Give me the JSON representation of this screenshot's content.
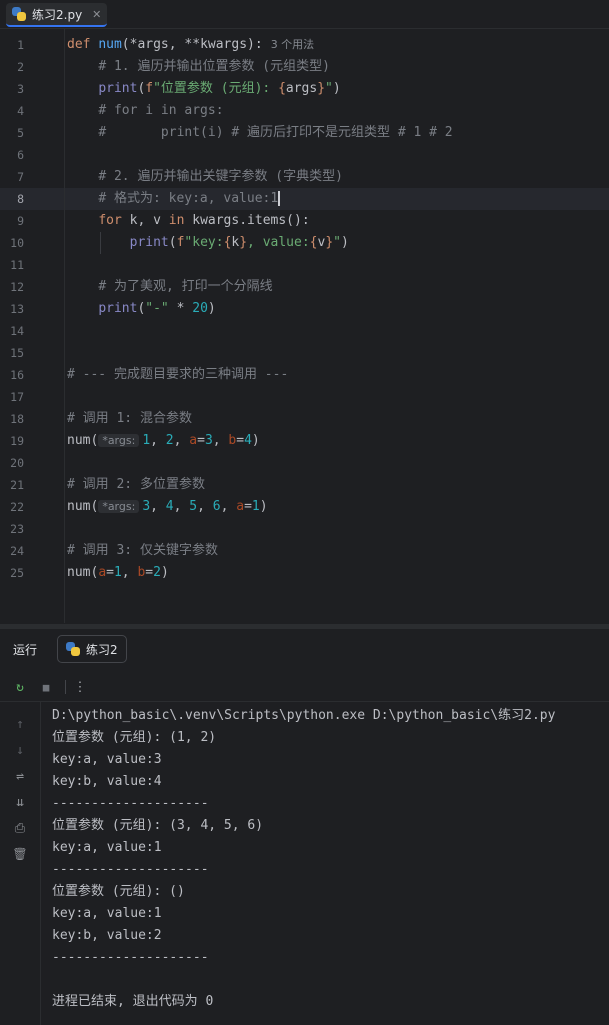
{
  "tab": {
    "filename": "练习2.py",
    "close": "✕"
  },
  "editor": {
    "line_numbers": [
      "1",
      "2",
      "3",
      "4",
      "5",
      "6",
      "7",
      "8",
      "9",
      "10",
      "11",
      "12",
      "13",
      "14",
      "15",
      "16",
      "17",
      "18",
      "19",
      "20",
      "21",
      "22",
      "23",
      "24",
      "25"
    ],
    "current_line": "8",
    "usages_hint": "3 个用法",
    "inlay_args": "*args:",
    "lines": {
      "l1": {
        "def": "def ",
        "name": "num",
        "sig": "(*args, **kwargs):"
      },
      "l2": "# 1. 遍历并输出位置参数 (元组类型)",
      "l3": {
        "fn": "print",
        "open": "(",
        "f": "f",
        "str1": "\"位置参数 (元组): ",
        "lb": "{",
        "var": "args",
        "rb": "}",
        "str2": "\"",
        "close": ")"
      },
      "l4": "# for i in args:",
      "l5": "#       print(i) # 遍历后打印不是元组类型 # 1 # 2",
      "l7": "# 2. 遍历并输出关键字参数 (字典类型)",
      "l8": "# 格式为: key:a, value:1",
      "l9": {
        "for": "for ",
        "vars": "k, v ",
        "in": "in ",
        "expr": "kwargs.items():"
      },
      "l10": {
        "fn": "print",
        "open": "(",
        "f": "f",
        "str1": "\"key:",
        "lb1": "{",
        "k": "k",
        "rb1": "}",
        "str2": ", value:",
        "lb2": "{",
        "v": "v",
        "rb2": "}",
        "str3": "\"",
        "close": ")"
      },
      "l12": "# 为了美观, 打印一个分隔线",
      "l13": {
        "fn": "print",
        "open": "(",
        "str": "\"-\"",
        "op": " * ",
        "num": "20",
        "close": ")"
      },
      "l16": "# --- 完成题目要求的三种调用 ---",
      "l18": "# 调用 1: 混合参数",
      "l19": {
        "name": "num",
        "open": "(",
        "a1": "1",
        "c1": ", ",
        "a2": "2",
        "c2": ", ",
        "ka": "a",
        "eq1": "=",
        "va": "3",
        "c3": ", ",
        "kb": "b",
        "eq2": "=",
        "vb": "4",
        "close": ")"
      },
      "l21": "# 调用 2: 多位置参数",
      "l22": {
        "name": "num",
        "open": "(",
        "a1": "3",
        "c1": ", ",
        "a2": "4",
        "c2": ", ",
        "a3": "5",
        "c3": ", ",
        "a4": "6",
        "c4": ", ",
        "ka": "a",
        "eq": "=",
        "va": "1",
        "close": ")"
      },
      "l24": "# 调用 3: 仅关键字参数",
      "l25": {
        "name": "num",
        "open": "(",
        "ka": "a",
        "eq1": "=",
        "va": "1",
        "c1": ", ",
        "kb": "b",
        "eq2": "=",
        "vb": "2",
        "close": ")"
      }
    }
  },
  "run_panel": {
    "label": "运行",
    "tab_name": "练习2",
    "output": [
      "D:\\python_basic\\.venv\\Scripts\\python.exe D:\\python_basic\\练习2.py",
      "位置参数 (元组): (1, 2)",
      "key:a, value:3",
      "key:b, value:4",
      "--------------------",
      "位置参数 (元组): (3, 4, 5, 6)",
      "key:a, value:1",
      "--------------------",
      "位置参数 (元组): ()",
      "key:a, value:1",
      "key:b, value:2",
      "--------------------",
      "",
      "进程已结束, 退出代码为 0"
    ]
  },
  "icons": {
    "rerun": "↻",
    "stop": "■",
    "more": "⋮",
    "up": "↑",
    "down": "↓",
    "wrap": "⇌",
    "scroll_end": "⇊",
    "print": "⎙",
    "trash": "🗑"
  },
  "colors": {
    "accent": "#3574f0",
    "background": "#1e1f22",
    "keyword": "#cf8e6d",
    "function": "#56a8f5",
    "string": "#6aab73",
    "number": "#2aacb8",
    "comment": "#7a7e85"
  }
}
